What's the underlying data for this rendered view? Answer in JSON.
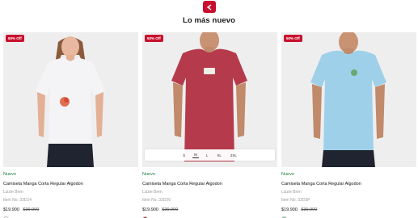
{
  "header": {
    "logo_icon": "brand-arrow-icon",
    "brand_color": "#c8102e",
    "title": "Lo más nuevo"
  },
  "products": [
    {
      "discount": "50% Off",
      "tag": "Nuevo",
      "name": "Camiseta Manga Corta Regular Algodon",
      "brand": "Lizzie Bren",
      "sku": "Item No. 32D14",
      "price": "$19.900",
      "old_price": "$39.900",
      "shirt_color": "#f4f4f6",
      "swatch_color": "#ffffff",
      "gender": "female"
    },
    {
      "discount": "50% Off",
      "tag": "Nuevo",
      "name": "Camiseta Manga Corta Regular Algodon",
      "brand": "Lizzie Bren",
      "sku": "Item No. 32D26",
      "price": "$19.900",
      "old_price": "$39.900",
      "shirt_color": "#b53a4c",
      "swatch_color": "#9b2335",
      "gender": "male",
      "sizes": [
        "S",
        "M",
        "L",
        "XL",
        "2XL"
      ],
      "selected_size": "M"
    },
    {
      "discount": "50% Off",
      "tag": "Nuevo",
      "name": "Camiseta Manga Corta Regular Algodon",
      "brand": "Lizzie Bren",
      "sku": "Item No. 32D3P",
      "price": "$19.900",
      "old_price": "$39.900",
      "shirt_color": "#9fd0ea",
      "swatch_color": "#8fc9a8",
      "gender": "male"
    }
  ]
}
